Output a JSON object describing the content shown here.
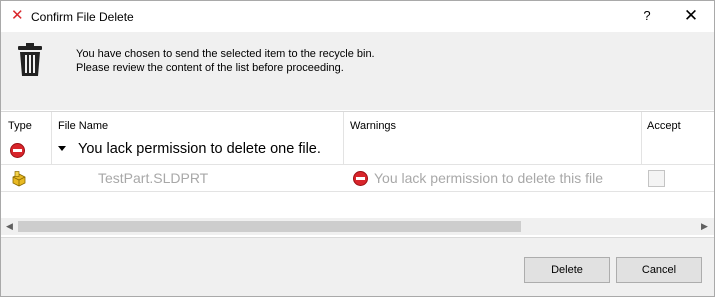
{
  "window": {
    "title": "Confirm File Delete",
    "help_label": "?",
    "close_label": "✕"
  },
  "info": {
    "line1": "You have chosen to send the selected item to the recycle bin.",
    "line2": "Please review the content of the list before proceeding."
  },
  "grid": {
    "columns": [
      "Type",
      "File Name",
      "Warnings",
      "Accept"
    ],
    "group": {
      "label": "You lack permission to delete one file."
    },
    "rows": [
      {
        "file_name": "TestPart.SLDPRT",
        "warning": "You lack permission to delete this file",
        "accepted": false
      }
    ]
  },
  "scrollbar": {
    "left_arrow": "◀",
    "right_arrow": "▶",
    "thumb_fraction": 0.74
  },
  "footer": {
    "delete_label": "Delete",
    "cancel_label": "Cancel"
  },
  "colors": {
    "error_red": "#d8252b",
    "disabled_text": "#a8a8a8",
    "panel_bg": "#f0f0f0"
  }
}
